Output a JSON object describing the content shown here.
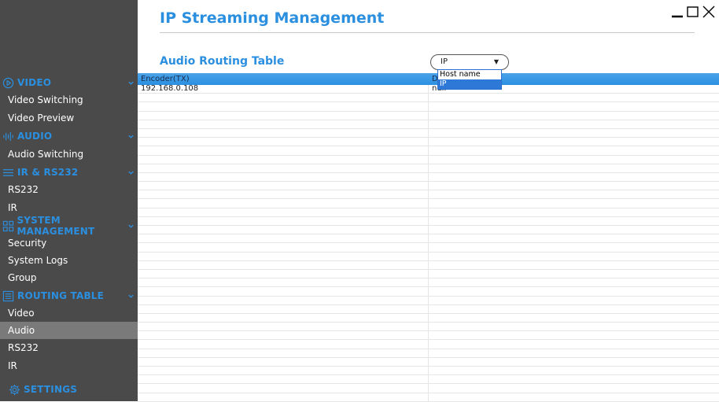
{
  "header": {
    "title": "IP Streaming Management",
    "subtitle": "Audio Routing Table"
  },
  "select": {
    "value": "IP",
    "options": [
      "Host name",
      "IP"
    ],
    "selected_index": 1
  },
  "table": {
    "columns": [
      "Encoder(TX)",
      "D"
    ],
    "rows": [
      [
        "192.168.0.108",
        "null"
      ]
    ]
  },
  "sidebar": {
    "sections": [
      {
        "label": "VIDEO",
        "icon": "play-circle-icon",
        "items": [
          "Video Switching",
          "Video Preview"
        ]
      },
      {
        "label": "AUDIO",
        "icon": "audio-wave-icon",
        "items": [
          "Audio Switching"
        ]
      },
      {
        "label": "IR & RS232",
        "icon": "lines-icon",
        "items": [
          "RS232",
          "IR"
        ]
      },
      {
        "label": "SYSTEM MANAGEMENT",
        "icon": "grid-icon",
        "items": [
          "Security",
          "System Logs",
          "Group"
        ]
      },
      {
        "label": "ROUTING TABLE",
        "icon": "list-box-icon",
        "items": [
          "Video",
          "Audio",
          "RS232",
          "IR"
        ]
      }
    ],
    "settings_label": "SETTINGS",
    "active_item": "Audio"
  },
  "colors": {
    "accent": "#2b8fe0",
    "sidebar_bg": "#4a4a4a",
    "active_bg": "#7a7a7a"
  }
}
